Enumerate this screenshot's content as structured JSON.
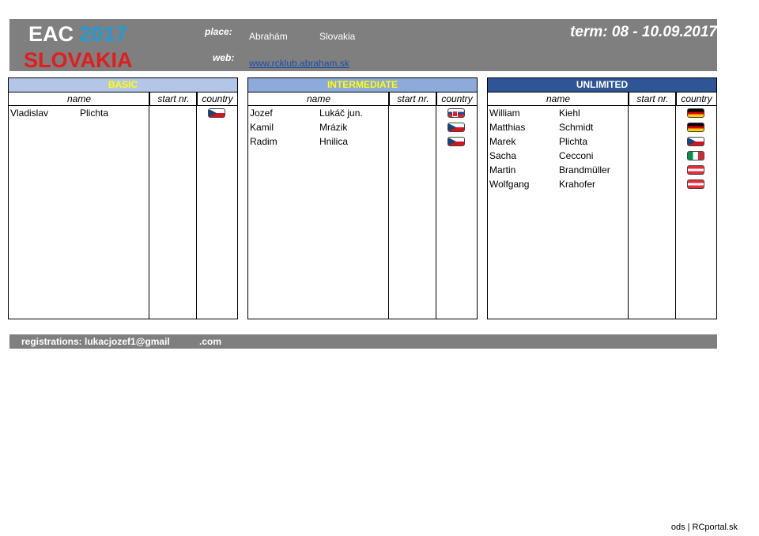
{
  "header": {
    "eac": "EAC",
    "year": "2017",
    "country_title": "SLOVAKIA",
    "place_label": "place:",
    "place_town": "Abrahám",
    "place_country": "Slovakia",
    "web_label": "web:",
    "web_url": "www.rcklub.abraham.sk",
    "term": "term: 08 - 10.09.2017"
  },
  "columns": {
    "name": "name",
    "start": "start nr.",
    "country": "country"
  },
  "categories": [
    {
      "title": "BASIC",
      "pilots": [
        {
          "first": "Vladislav",
          "last": "Plichta",
          "flag": "flag-cz"
        }
      ]
    },
    {
      "title": "INTERMEDIATE",
      "pilots": [
        {
          "first": "Jozef",
          "last": "Lukáč jun.",
          "flag": "flag-sk"
        },
        {
          "first": "Kamil",
          "last": "Mrázik",
          "flag": "flag-cz"
        },
        {
          "first": "Radim",
          "last": "Hnilica",
          "flag": "flag-cz"
        }
      ]
    },
    {
      "title": "UNLIMITED",
      "pilots": [
        {
          "first": "William",
          "last": "Kiehl",
          "flag": "flag-de"
        },
        {
          "first": "Matthias",
          "last": "Schmidt",
          "flag": "flag-de"
        },
        {
          "first": "Marek",
          "last": "Plichta",
          "flag": "flag-cz"
        },
        {
          "first": "Sacha",
          "last": "Cecconi",
          "flag": "flag-it"
        },
        {
          "first": "Martin",
          "last": "Brandmüller",
          "flag": "flag-at"
        },
        {
          "first": "Wolfgang",
          "last": "Krahofer",
          "flag": "flag-at"
        }
      ]
    }
  ],
  "footer": {
    "registrations": "registrations: lukacjozef1@gmail",
    "com": ".com",
    "credit": "ods | RCportal.sk"
  }
}
